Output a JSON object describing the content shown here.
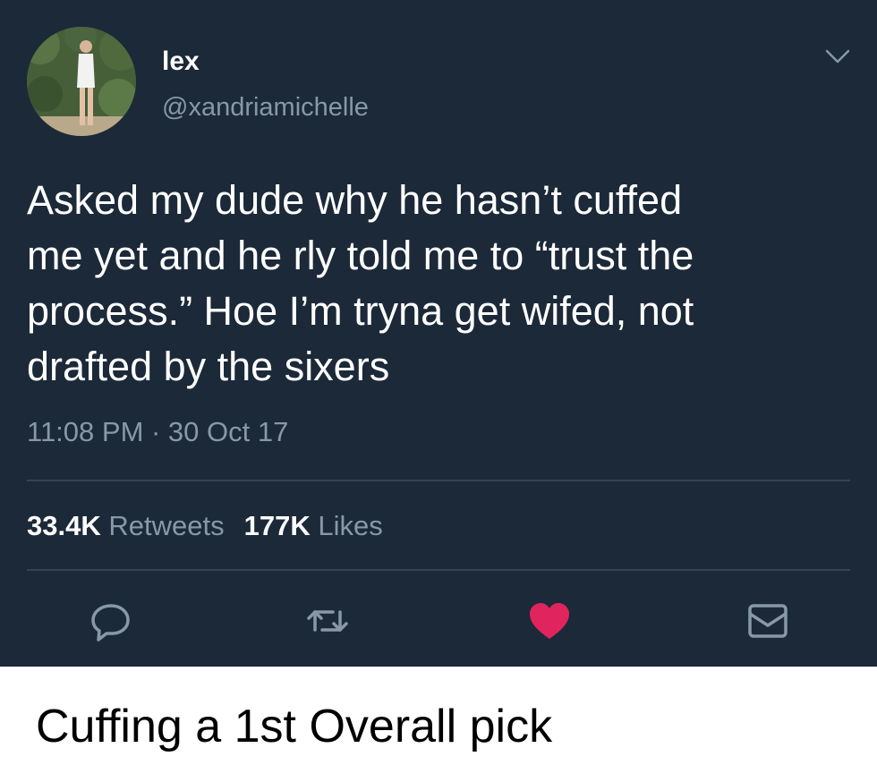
{
  "tweet": {
    "display_name": "lex",
    "handle": "@xandriamichelle",
    "text_lines": [
      "Asked my dude why he hasn’t cuffed",
      "me yet and he rly told me to “trust the",
      "process.” Hoe I’m tryna get wifed, not",
      "drafted by the sixers"
    ],
    "timestamp": "11:08 PM · 30 Oct 17",
    "retweets_count": "33.4K",
    "retweets_label": "Retweets",
    "likes_count": "177K",
    "likes_label": "Likes",
    "actions": [
      "reply-icon",
      "retweet-icon",
      "heart-icon",
      "message-icon"
    ],
    "liked": true
  },
  "caption": "Cuffing a 1st Overall pick",
  "colors": {
    "background": "#1c2938",
    "muted_text": "#8899a6",
    "divider": "#38444d",
    "like_red": "#e0245e"
  }
}
